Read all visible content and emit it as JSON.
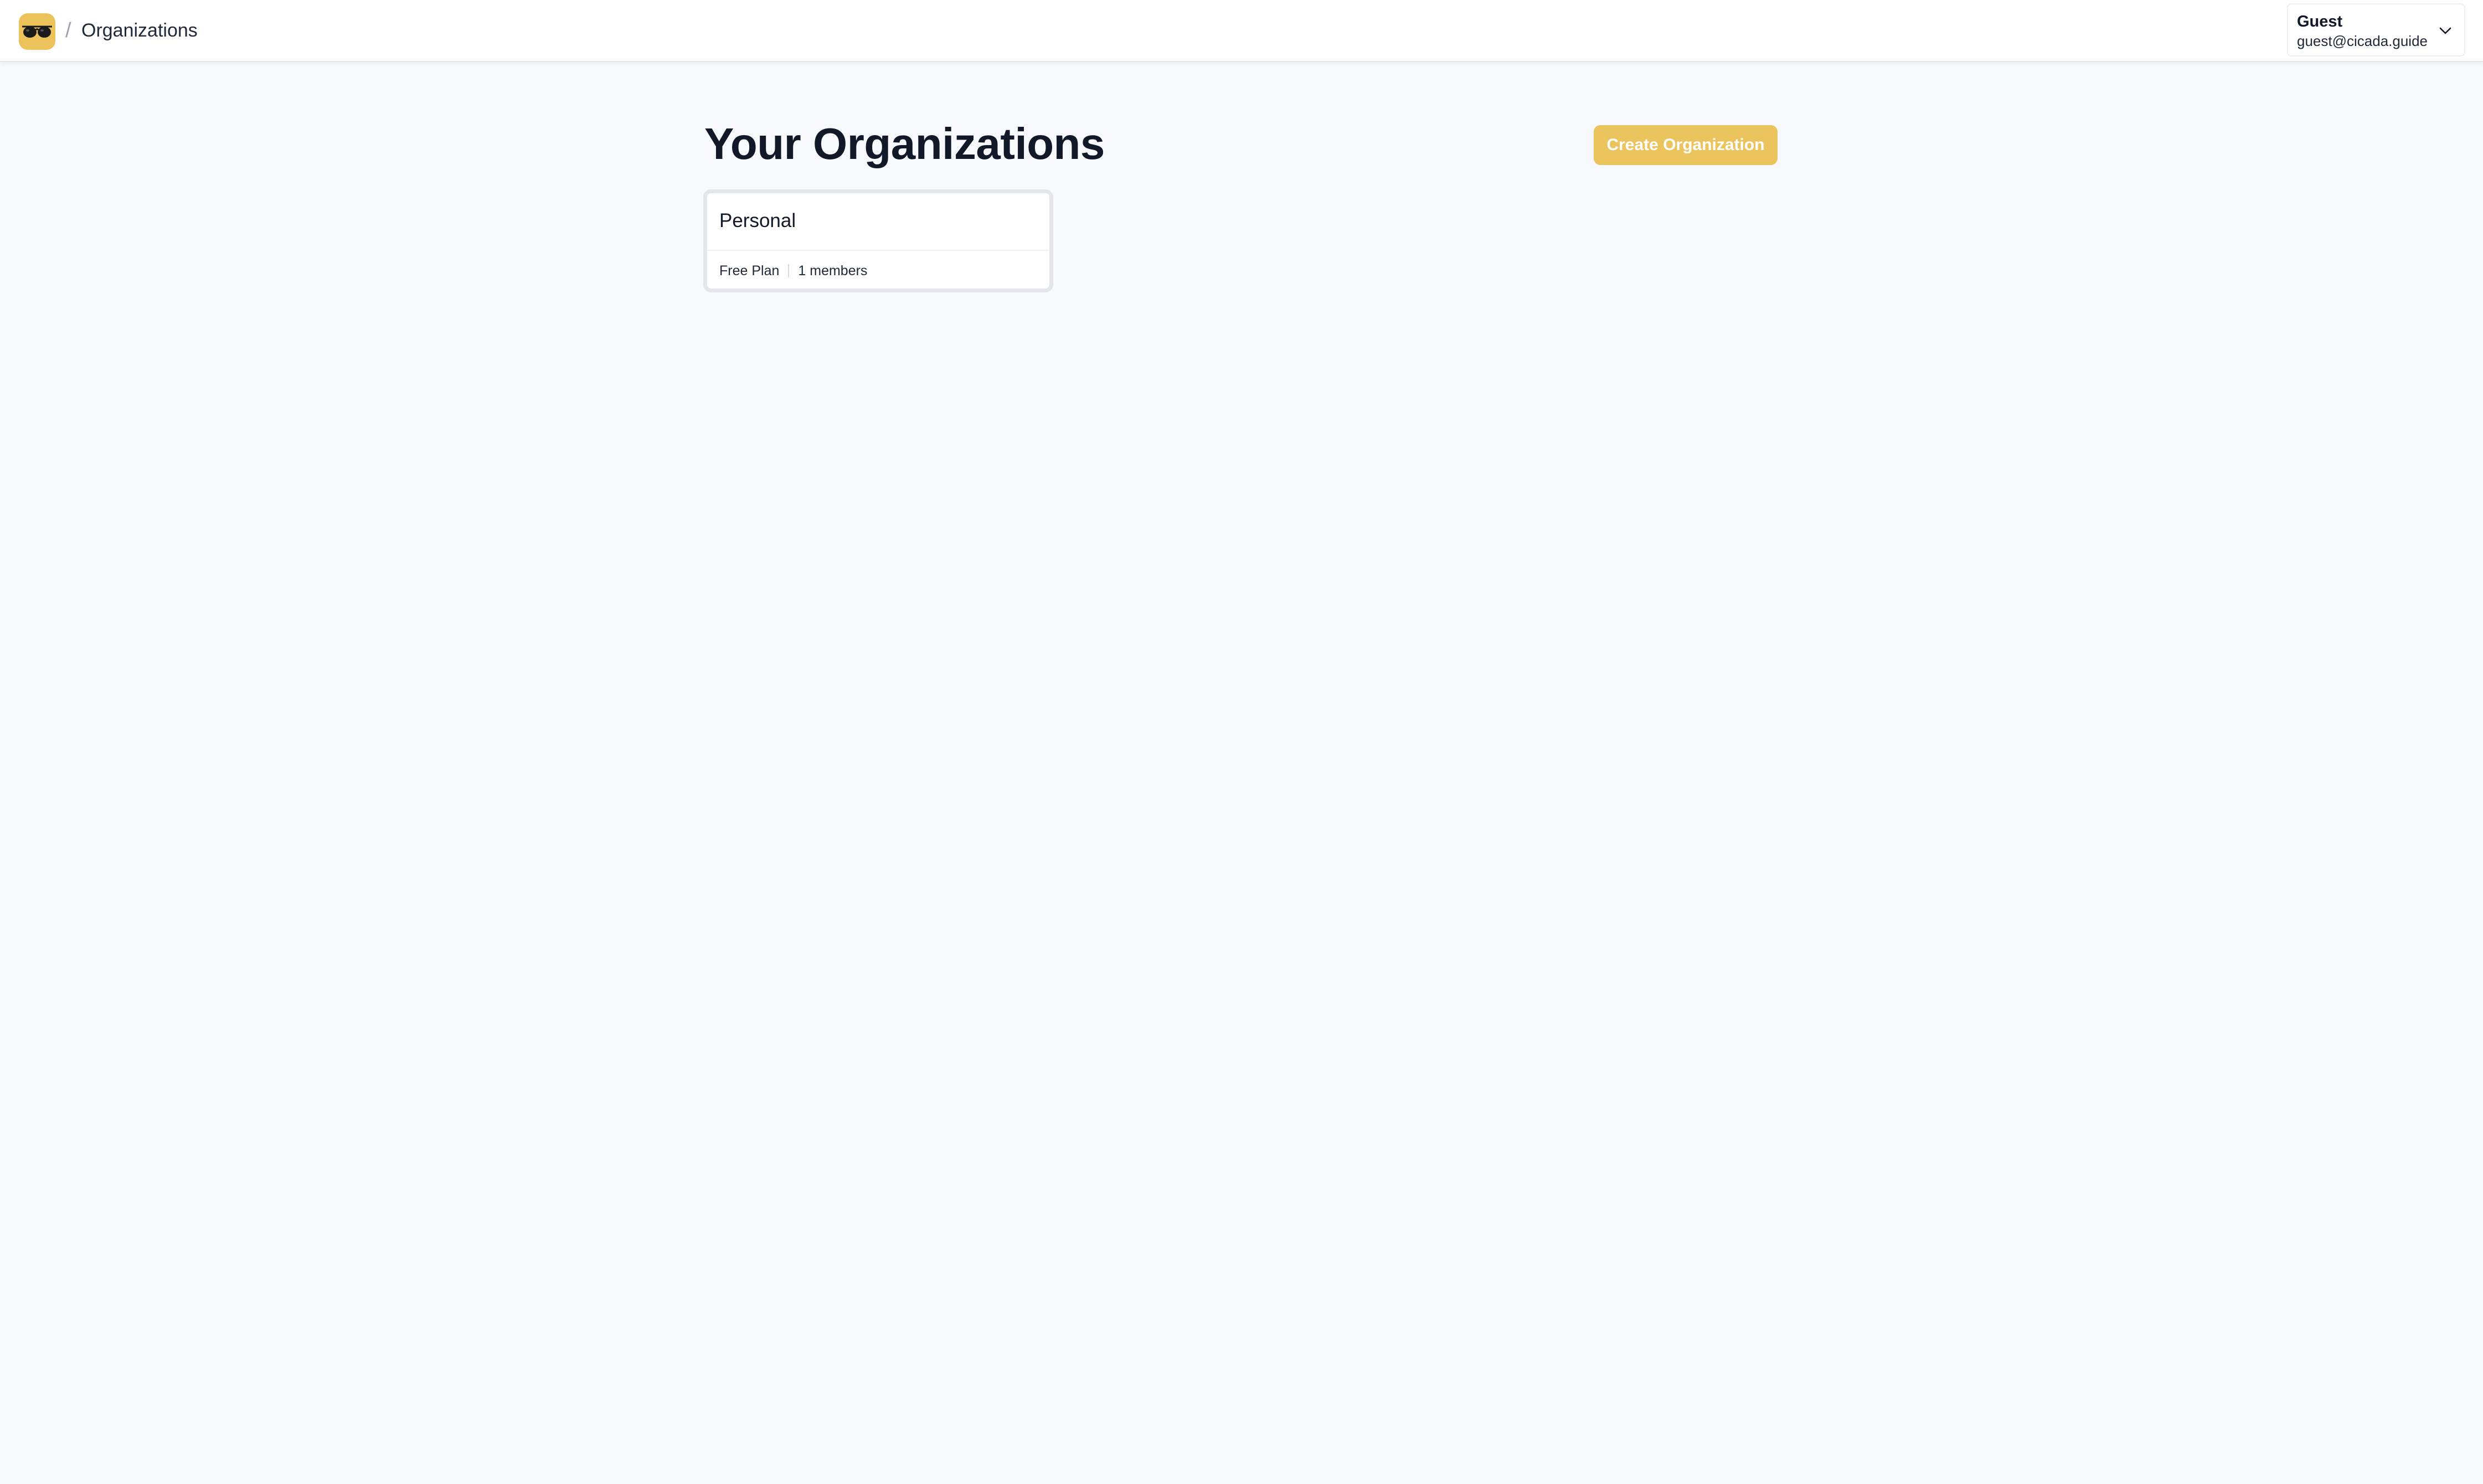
{
  "header": {
    "logo_icon": "sunglasses-icon",
    "breadcrumb_separator": "/",
    "breadcrumb_current": "Organizations"
  },
  "user": {
    "name": "Guest",
    "email": "guest@cicada.guide",
    "menu_icon": "chevron-down-icon"
  },
  "main": {
    "title": "Your Organizations",
    "create_button_label": "Create Organization",
    "organizations": [
      {
        "name": "Personal",
        "plan": "Free Plan",
        "members": "1 members"
      }
    ]
  },
  "colors": {
    "accent": "#ebc45d",
    "background": "#f8f9fc",
    "card_border": "#e4e6ea"
  }
}
